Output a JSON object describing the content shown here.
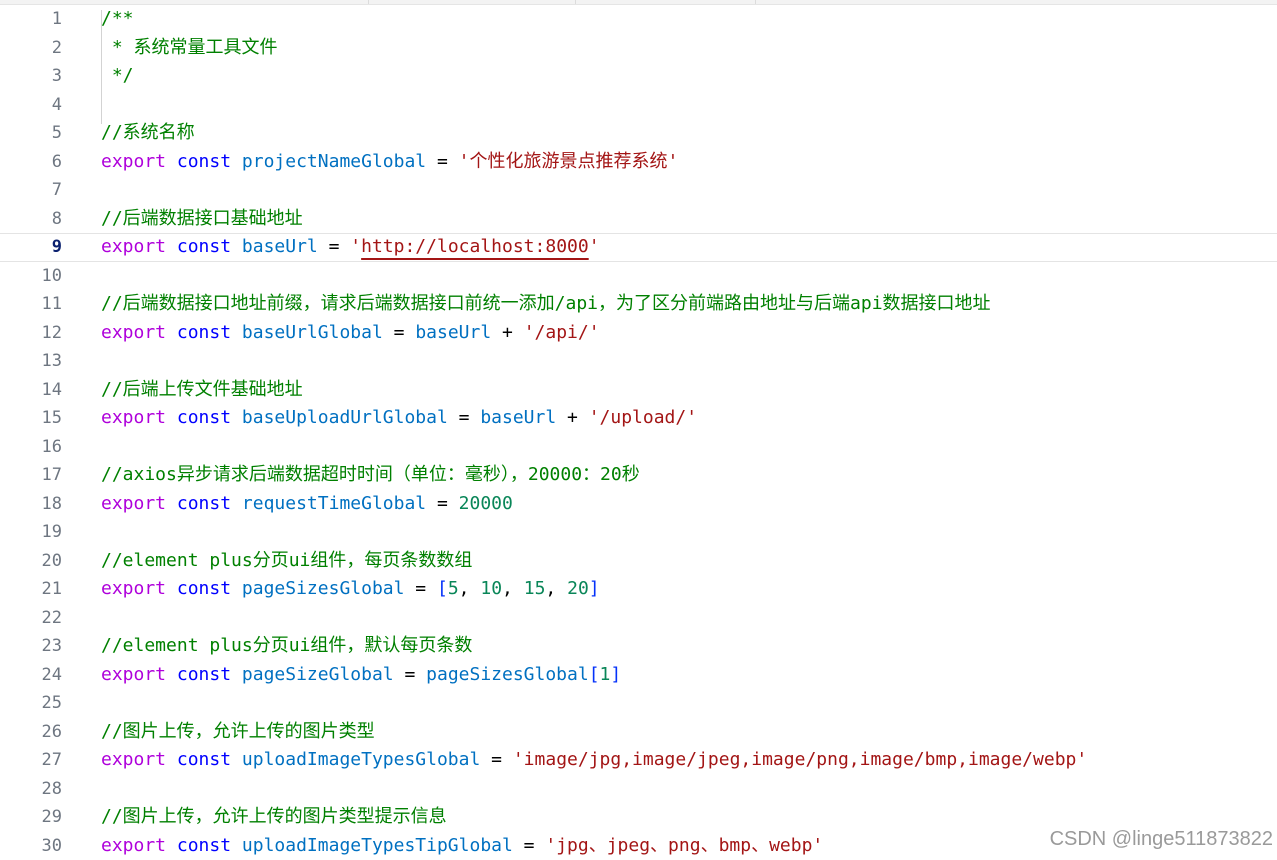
{
  "editor": {
    "current_line": 9,
    "lines": [
      {
        "n": "1",
        "tokens": [
          {
            "t": "/**",
            "c": "comment"
          }
        ]
      },
      {
        "n": "2",
        "tokens": [
          {
            "t": " * 系统常量工具文件",
            "c": "comment"
          }
        ]
      },
      {
        "n": "3",
        "tokens": [
          {
            "t": " */",
            "c": "comment"
          }
        ]
      },
      {
        "n": "4",
        "tokens": []
      },
      {
        "n": "5",
        "tokens": [
          {
            "t": "//系统名称",
            "c": "comment"
          }
        ]
      },
      {
        "n": "6",
        "tokens": [
          {
            "t": "export",
            "c": "keyword"
          },
          {
            "t": " ",
            "c": "op"
          },
          {
            "t": "const",
            "c": "const"
          },
          {
            "t": " ",
            "c": "op"
          },
          {
            "t": "projectNameGlobal",
            "c": "var"
          },
          {
            "t": " = ",
            "c": "op"
          },
          {
            "t": "'个性化旅游景点推荐系统'",
            "c": "string"
          }
        ]
      },
      {
        "n": "7",
        "tokens": []
      },
      {
        "n": "8",
        "tokens": [
          {
            "t": "//后端数据接口基础地址",
            "c": "comment"
          }
        ]
      },
      {
        "n": "9",
        "tokens": [
          {
            "t": "export",
            "c": "keyword"
          },
          {
            "t": " ",
            "c": "op"
          },
          {
            "t": "const",
            "c": "const"
          },
          {
            "t": " ",
            "c": "op"
          },
          {
            "t": "baseUrl",
            "c": "var"
          },
          {
            "t": " = ",
            "c": "op"
          },
          {
            "t": "'",
            "c": "string"
          },
          {
            "t": "http://localhost:8000",
            "c": "string squiggle"
          },
          {
            "t": "'",
            "c": "string"
          }
        ]
      },
      {
        "n": "10",
        "tokens": []
      },
      {
        "n": "11",
        "tokens": [
          {
            "t": "//后端数据接口地址前缀，请求后端数据接口前统一添加/api，为了区分前端路由地址与后端api数据接口地址",
            "c": "comment"
          }
        ]
      },
      {
        "n": "12",
        "tokens": [
          {
            "t": "export",
            "c": "keyword"
          },
          {
            "t": " ",
            "c": "op"
          },
          {
            "t": "const",
            "c": "const"
          },
          {
            "t": " ",
            "c": "op"
          },
          {
            "t": "baseUrlGlobal",
            "c": "var"
          },
          {
            "t": " = ",
            "c": "op"
          },
          {
            "t": "baseUrl",
            "c": "var"
          },
          {
            "t": " + ",
            "c": "op"
          },
          {
            "t": "'/api/'",
            "c": "string"
          }
        ]
      },
      {
        "n": "13",
        "tokens": []
      },
      {
        "n": "14",
        "tokens": [
          {
            "t": "//后端上传文件基础地址",
            "c": "comment"
          }
        ]
      },
      {
        "n": "15",
        "tokens": [
          {
            "t": "export",
            "c": "keyword"
          },
          {
            "t": " ",
            "c": "op"
          },
          {
            "t": "const",
            "c": "const"
          },
          {
            "t": " ",
            "c": "op"
          },
          {
            "t": "baseUploadUrlGlobal",
            "c": "var"
          },
          {
            "t": " = ",
            "c": "op"
          },
          {
            "t": "baseUrl",
            "c": "var"
          },
          {
            "t": " + ",
            "c": "op"
          },
          {
            "t": "'/upload/'",
            "c": "string"
          }
        ]
      },
      {
        "n": "16",
        "tokens": []
      },
      {
        "n": "17",
        "tokens": [
          {
            "t": "//axios异步请求后端数据超时时间（单位：毫秒），20000：20秒",
            "c": "comment"
          }
        ]
      },
      {
        "n": "18",
        "tokens": [
          {
            "t": "export",
            "c": "keyword"
          },
          {
            "t": " ",
            "c": "op"
          },
          {
            "t": "const",
            "c": "const"
          },
          {
            "t": " ",
            "c": "op"
          },
          {
            "t": "requestTimeGlobal",
            "c": "var"
          },
          {
            "t": " = ",
            "c": "op"
          },
          {
            "t": "20000",
            "c": "number"
          }
        ]
      },
      {
        "n": "19",
        "tokens": []
      },
      {
        "n": "20",
        "tokens": [
          {
            "t": "//element plus分页ui组件，每页条数数组",
            "c": "comment"
          }
        ]
      },
      {
        "n": "21",
        "tokens": [
          {
            "t": "export",
            "c": "keyword"
          },
          {
            "t": " ",
            "c": "op"
          },
          {
            "t": "const",
            "c": "const"
          },
          {
            "t": " ",
            "c": "op"
          },
          {
            "t": "pageSizesGlobal",
            "c": "var"
          },
          {
            "t": " = ",
            "c": "op"
          },
          {
            "t": "[",
            "c": "bracket"
          },
          {
            "t": "5",
            "c": "number"
          },
          {
            "t": ", ",
            "c": "op"
          },
          {
            "t": "10",
            "c": "number"
          },
          {
            "t": ", ",
            "c": "op"
          },
          {
            "t": "15",
            "c": "number"
          },
          {
            "t": ", ",
            "c": "op"
          },
          {
            "t": "20",
            "c": "number"
          },
          {
            "t": "]",
            "c": "bracket"
          }
        ]
      },
      {
        "n": "22",
        "tokens": []
      },
      {
        "n": "23",
        "tokens": [
          {
            "t": "//element plus分页ui组件，默认每页条数",
            "c": "comment"
          }
        ]
      },
      {
        "n": "24",
        "tokens": [
          {
            "t": "export",
            "c": "keyword"
          },
          {
            "t": " ",
            "c": "op"
          },
          {
            "t": "const",
            "c": "const"
          },
          {
            "t": " ",
            "c": "op"
          },
          {
            "t": "pageSizeGlobal",
            "c": "var"
          },
          {
            "t": " = ",
            "c": "op"
          },
          {
            "t": "pageSizesGlobal",
            "c": "var"
          },
          {
            "t": "[",
            "c": "bracket"
          },
          {
            "t": "1",
            "c": "number"
          },
          {
            "t": "]",
            "c": "bracket"
          }
        ]
      },
      {
        "n": "25",
        "tokens": []
      },
      {
        "n": "26",
        "tokens": [
          {
            "t": "//图片上传，允许上传的图片类型",
            "c": "comment"
          }
        ]
      },
      {
        "n": "27",
        "tokens": [
          {
            "t": "export",
            "c": "keyword"
          },
          {
            "t": " ",
            "c": "op"
          },
          {
            "t": "const",
            "c": "const"
          },
          {
            "t": " ",
            "c": "op"
          },
          {
            "t": "uploadImageTypesGlobal",
            "c": "var"
          },
          {
            "t": " = ",
            "c": "op"
          },
          {
            "t": "'image/jpg,image/jpeg,image/png,image/bmp,image/webp'",
            "c": "string"
          }
        ]
      },
      {
        "n": "28",
        "tokens": []
      },
      {
        "n": "29",
        "tokens": [
          {
            "t": "//图片上传，允许上传的图片类型提示信息",
            "c": "comment"
          }
        ]
      },
      {
        "n": "30",
        "tokens": [
          {
            "t": "export",
            "c": "keyword"
          },
          {
            "t": " ",
            "c": "op"
          },
          {
            "t": "const",
            "c": "const"
          },
          {
            "t": " ",
            "c": "op"
          },
          {
            "t": "uploadImageTypesTipGlobal",
            "c": "var"
          },
          {
            "t": " = ",
            "c": "op"
          },
          {
            "t": "'jpg、jpeg、png、bmp、webp'",
            "c": "string"
          }
        ]
      }
    ]
  },
  "watermark": {
    "text": "CSDN @linge511873822"
  },
  "colors": {
    "comment": "#008000",
    "keyword": "#af00db",
    "const": "#0000ff",
    "variable": "#0070c1",
    "string": "#a31515",
    "number": "#098658",
    "line_number": "#6e7681"
  }
}
